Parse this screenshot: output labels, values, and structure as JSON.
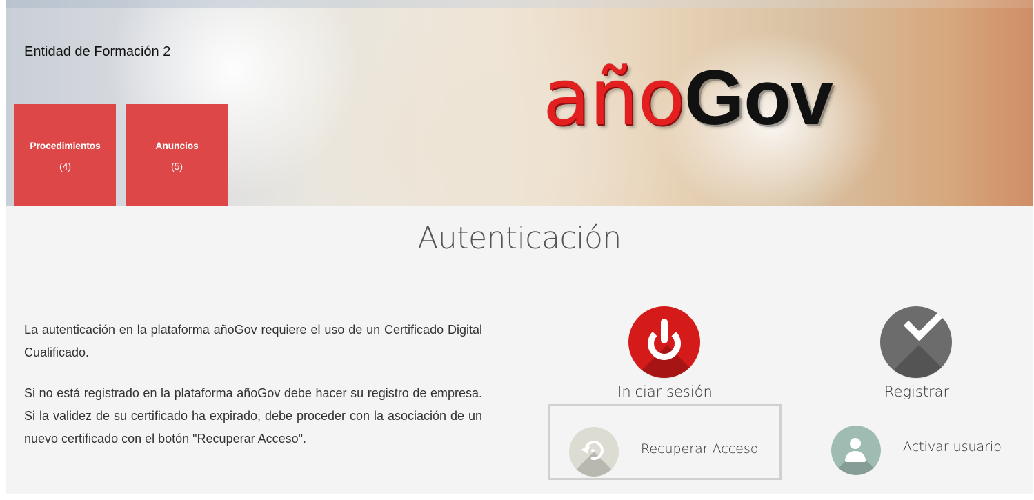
{
  "header": {
    "entity_name": "Entidad de Formación 2",
    "logo": {
      "red_text": "año",
      "black_text": "Gov",
      "colors": {
        "red": "#e41f1f",
        "black": "#111111"
      }
    },
    "tiles": [
      {
        "label": "Procedimientos",
        "count": "(4)",
        "color": "#dd4747"
      },
      {
        "label": "Anuncios",
        "count": "(5)",
        "color": "#dd4747"
      }
    ]
  },
  "main": {
    "title": "Autenticación",
    "description": {
      "paragraph_1": "La autenticación en la plataforma añoGov requiere el uso de un Certificado Digital Cualificado.",
      "paragraph_2": "Si no está registrado en la plataforma añoGov debe hacer su registro de empresa. Si la validez de su certificado ha expirado, debe proceder con la asociación de un nuevo certificado con el botón \"Recuperar Acceso\"."
    },
    "actions": {
      "login": {
        "label": "Iniciar sesión",
        "icon": "power-icon",
        "color": "#d51a1a"
      },
      "register": {
        "label": "Registrar",
        "icon": "check-icon",
        "color": "#6c6c6c"
      },
      "recover_access": {
        "label": "Recuperar Acceso",
        "icon": "refresh-icon",
        "color": "#dcdcd3"
      },
      "activate_user": {
        "label": "Activar usuario",
        "icon": "user-icon",
        "color": "#9fbcb3"
      }
    }
  }
}
